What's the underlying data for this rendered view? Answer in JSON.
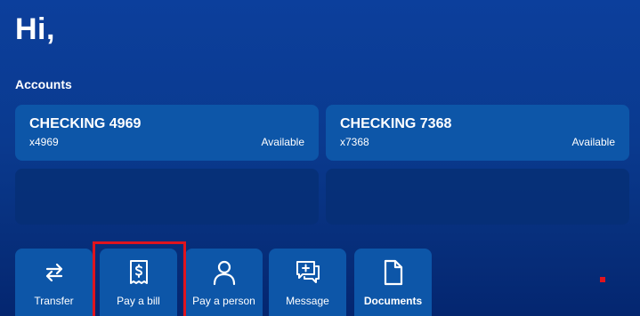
{
  "greeting": "Hi,",
  "accounts": {
    "label": "Accounts",
    "cards": [
      {
        "name": "CHECKING 4969",
        "mask": "x4969",
        "status": "Available"
      },
      {
        "name": "CHECKING 7368",
        "mask": "x7368",
        "status": "Available"
      }
    ]
  },
  "actions": [
    {
      "label": "Transfer",
      "icon": "transfer-arrows-icon"
    },
    {
      "label": "Pay a bill",
      "icon": "receipt-dollar-icon"
    },
    {
      "label": "Pay a person",
      "icon": "person-icon"
    },
    {
      "label": "Message",
      "icon": "message-plus-icon"
    },
    {
      "label": "Documents",
      "icon": "document-icon"
    }
  ],
  "colors": {
    "background": "#0a3a8f",
    "card": "#0d56a8",
    "highlight": "#e0141e"
  }
}
